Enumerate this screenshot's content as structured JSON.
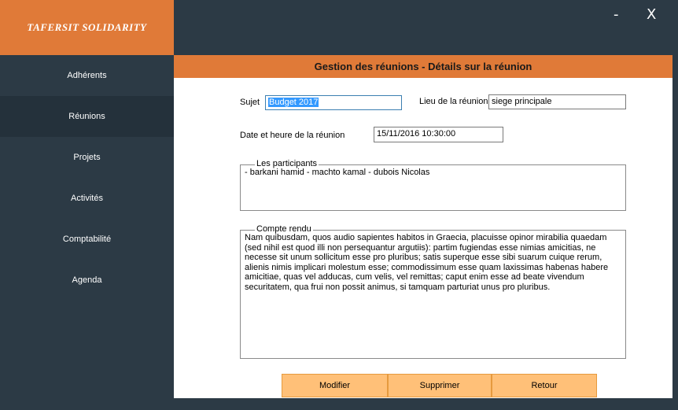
{
  "app": {
    "title": "TAFERSIT SOLIDARITY",
    "minimize": "-",
    "close": "X"
  },
  "sidebar": {
    "items": [
      {
        "label": "Adhérents"
      },
      {
        "label": "Réunions"
      },
      {
        "label": "Projets"
      },
      {
        "label": "Activités"
      },
      {
        "label": "Comptabilité"
      },
      {
        "label": "Agenda"
      }
    ]
  },
  "header": {
    "title": "Gestion des réunions - Détails sur la réunion"
  },
  "form": {
    "sujet_label": "Sujet",
    "sujet_value": "Budget 2017",
    "lieu_label": "Lieu de la réunion",
    "lieu_value": "siege principale",
    "date_label": "Date et heure de la réunion",
    "date_value": "15/11/2016 10:30:00",
    "participants_label": "Les participants",
    "participants_value": "- barkani  hamid - machto kamal - dubois Nicolas",
    "compte_rendu_label": "Compte rendu",
    "compte_rendu_value": "Nam quibusdam, quos audio sapientes habitos in Graecia, placuisse opinor mirabilia quaedam (sed nihil est quod illi non persequantur argutiis): partim fugiendas esse nimias amicitias, ne necesse sit unum sollicitum esse pro pluribus; satis superque esse sibi suarum cuique rerum, alienis nimis implicari molestum esse; commodissimum esse quam laxissimas habenas habere amicitiae, quas vel adducas, cum velis, vel remittas; caput enim esse ad beate vivendum securitatem, qua frui non possit animus, si tamquam parturiat unus pro pluribus."
  },
  "actions": {
    "modifier": "Modifier",
    "supprimer": "Supprimer",
    "retour": "Retour"
  },
  "colors": {
    "accent": "#e07a38",
    "sidebar_bg": "#2c3a45",
    "sidebar_active": "#24313b",
    "button_bg": "#ffc078"
  }
}
